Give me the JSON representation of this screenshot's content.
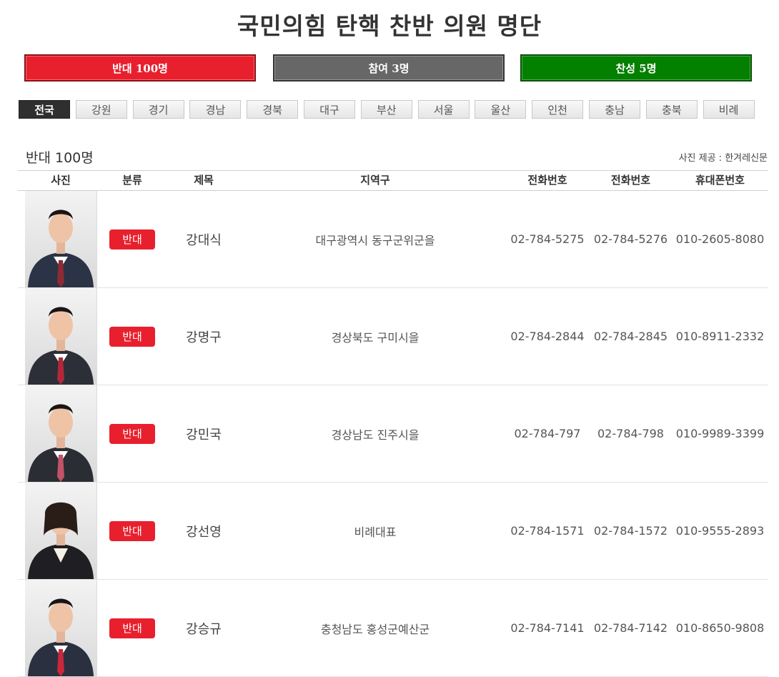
{
  "page": {
    "title": "국민의힘 탄핵 찬반 의원 명단"
  },
  "vote_tabs": [
    {
      "label": "반대 100명",
      "color": "#e8202e"
    },
    {
      "label": "참여 3명",
      "color": "#676767"
    },
    {
      "label": "찬성 5명",
      "color": "#048000"
    }
  ],
  "regions": [
    "전국",
    "강원",
    "경기",
    "경남",
    "경북",
    "대구",
    "부산",
    "서울",
    "울산",
    "인천",
    "충남",
    "충북",
    "비례"
  ],
  "active_region": "전국",
  "section": {
    "title": "반대 100명",
    "credit": "사진 제공 : 한겨레신문"
  },
  "table": {
    "headers": [
      "사진",
      "분류",
      "제목",
      "지역구",
      "전화번호",
      "전화번호",
      "휴대폰번호"
    ],
    "rows": [
      {
        "category": "반대",
        "name": "강대식",
        "district": "대구광역시 동구군위군을",
        "phone1": "02-784-5275",
        "phone2": "02-784-5276",
        "mobile": "010-2605-8080",
        "tie_color": "#8e2a34"
      },
      {
        "category": "반대",
        "name": "강명구",
        "district": "경상북도 구미시을",
        "phone1": "02-784-2844",
        "phone2": "02-784-2845",
        "mobile": "010-8911-2332",
        "tie_color": "#b0283a"
      },
      {
        "category": "반대",
        "name": "강민국",
        "district": "경상남도 진주시을",
        "phone1": "02-784-797",
        "phone2": "02-784-798",
        "mobile": "010-9989-3399",
        "tie_color": "#c25366"
      },
      {
        "category": "반대",
        "name": "강선영",
        "district": "비례대표",
        "phone1": "02-784-1571",
        "phone2": "02-784-1572",
        "mobile": "010-9555-2893",
        "tie_color": "#f4f4f4"
      },
      {
        "category": "반대",
        "name": "강승규",
        "district": "충청남도 홍성군예산군",
        "phone1": "02-784-7141",
        "phone2": "02-784-7142",
        "mobile": "010-8650-9808",
        "tie_color": "#c8283a"
      }
    ]
  },
  "colors": {
    "oppose": "#e8202e",
    "participate": "#676767",
    "favor": "#048000"
  }
}
